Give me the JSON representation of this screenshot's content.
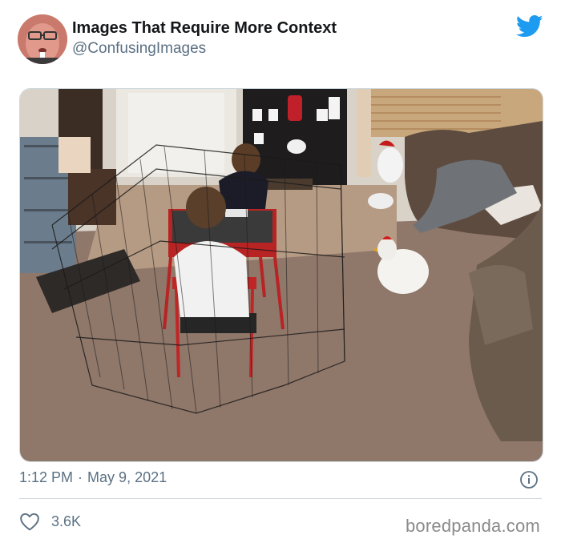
{
  "tweet": {
    "author": {
      "display_name": "Images That Require More Context",
      "handle": "@ConfusingImages",
      "avatar_icon": "profile-avatar"
    },
    "platform_icon": "twitter-bird-icon",
    "brand_color": "#1d9bf0",
    "time": "1:12 PM",
    "separator": "·",
    "date": "May 9, 2021",
    "info_icon": "info-icon",
    "likes": {
      "icon": "heart-icon",
      "count": "3.6K"
    }
  },
  "watermark": "boredpanda.com"
}
